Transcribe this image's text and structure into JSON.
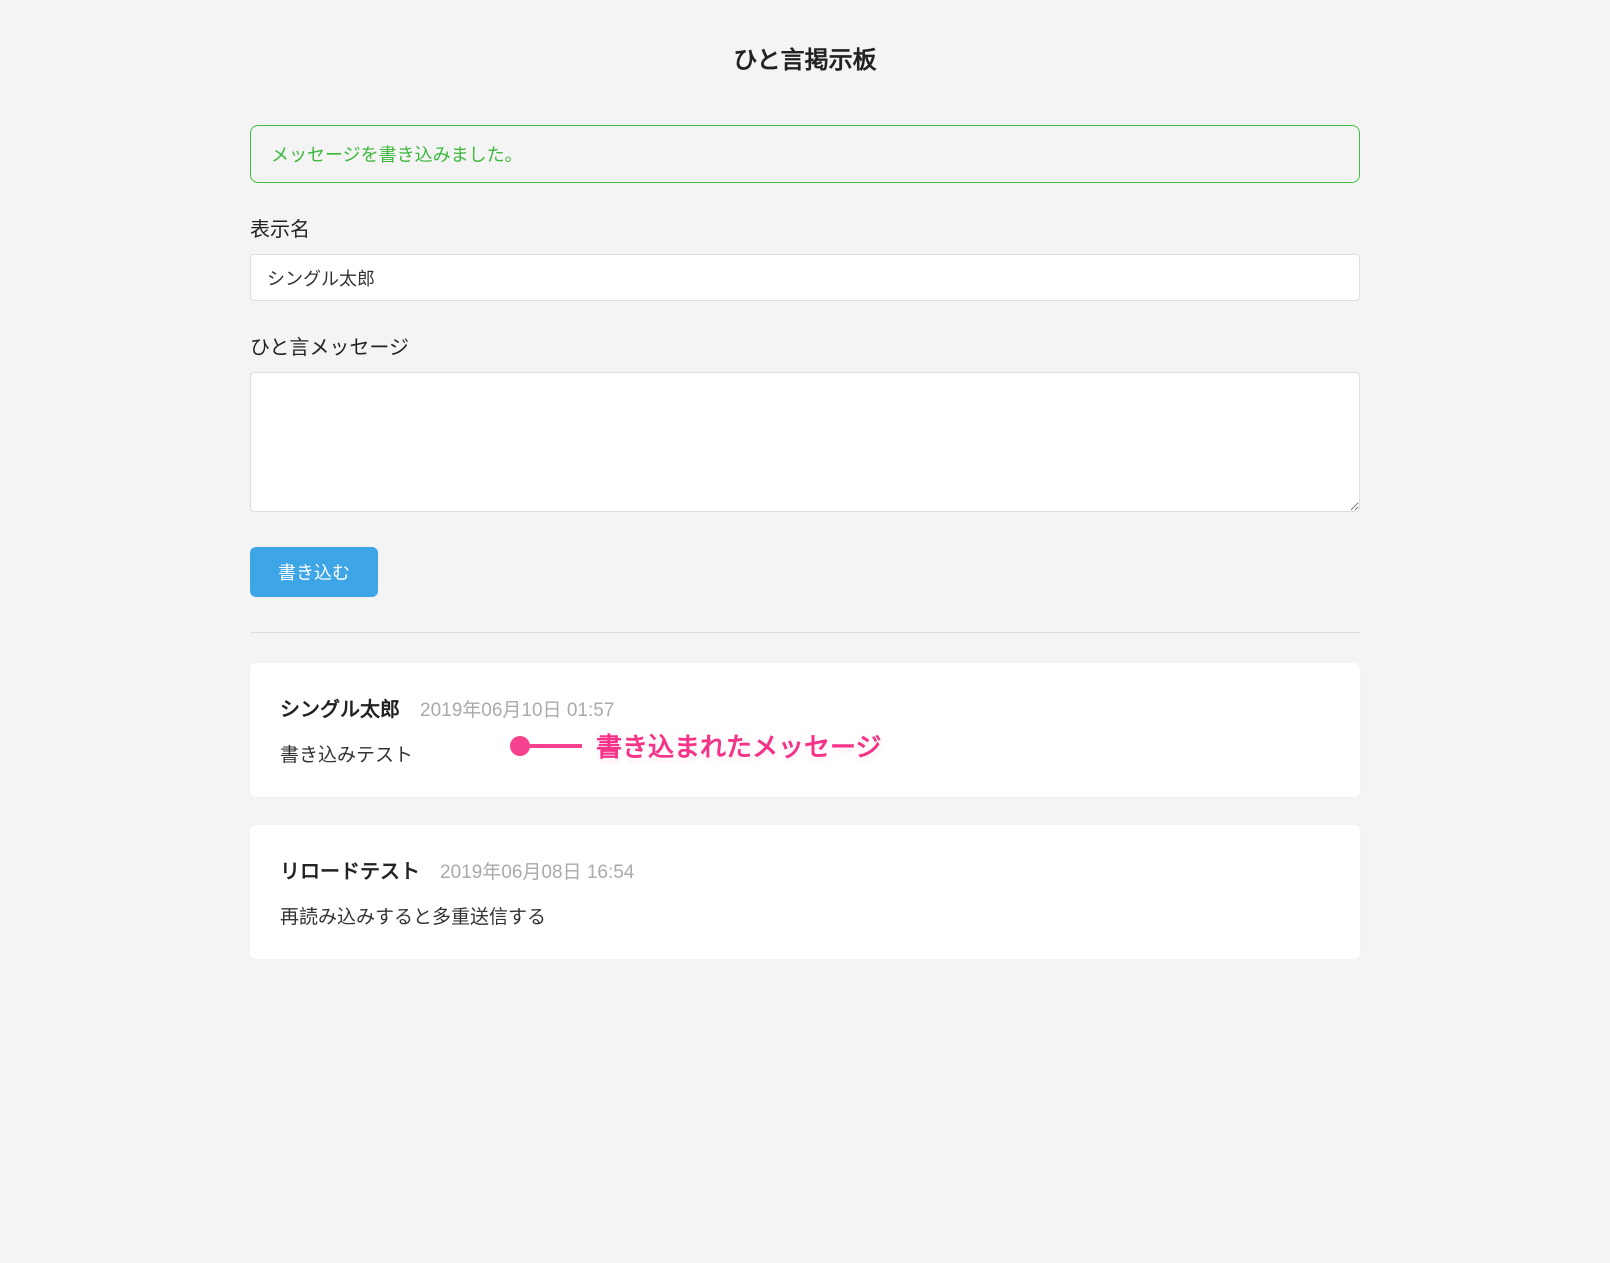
{
  "page": {
    "title": "ひと言掲示板"
  },
  "alert": {
    "text": "メッセージを書き込みました。"
  },
  "form": {
    "name_label": "表示名",
    "name_value": "シングル太郎",
    "message_label": "ひと言メッセージ",
    "message_value": "",
    "submit_label": "書き込む"
  },
  "messages": [
    {
      "author": "シングル太郎",
      "date": "2019年06月10日 01:57",
      "body": "書き込みテスト"
    },
    {
      "author": "リロードテスト",
      "date": "2019年06月08日 16:54",
      "body": "再読み込みすると多重送信する"
    }
  ],
  "annotation": {
    "label": "書き込まれたメッセージ"
  }
}
